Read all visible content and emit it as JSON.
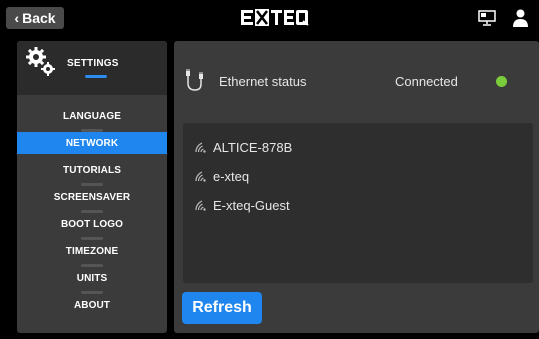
{
  "topbar": {
    "back_label": "Back",
    "logo_text": "E-XTEQ"
  },
  "sidebar": {
    "title": "SETTINGS",
    "items": [
      {
        "label": "LANGUAGE",
        "active": false
      },
      {
        "label": "NETWORK",
        "active": true
      },
      {
        "label": "TUTORIALS",
        "active": false
      },
      {
        "label": "SCREENSAVER",
        "active": false
      },
      {
        "label": "BOOT LOGO",
        "active": false
      },
      {
        "label": "TIMEZONE",
        "active": false
      },
      {
        "label": "UNITS",
        "active": false
      },
      {
        "label": "ABOUT",
        "active": false
      }
    ]
  },
  "network": {
    "ethernet_label": "Ethernet status",
    "ethernet_status": "Connected",
    "status_color": "#7bcc3b",
    "wifi_networks": [
      {
        "ssid": "ALTICE-878B",
        "icon": "wifi-icon"
      },
      {
        "ssid": "e-xteq",
        "icon": "wifi-icon"
      },
      {
        "ssid": "E-xteq-Guest",
        "icon": "wifi-icon"
      }
    ],
    "refresh_label": "Refresh"
  },
  "colors": {
    "accent": "#1f86f0",
    "panel": "#3b3b3b",
    "background": "#000000"
  }
}
